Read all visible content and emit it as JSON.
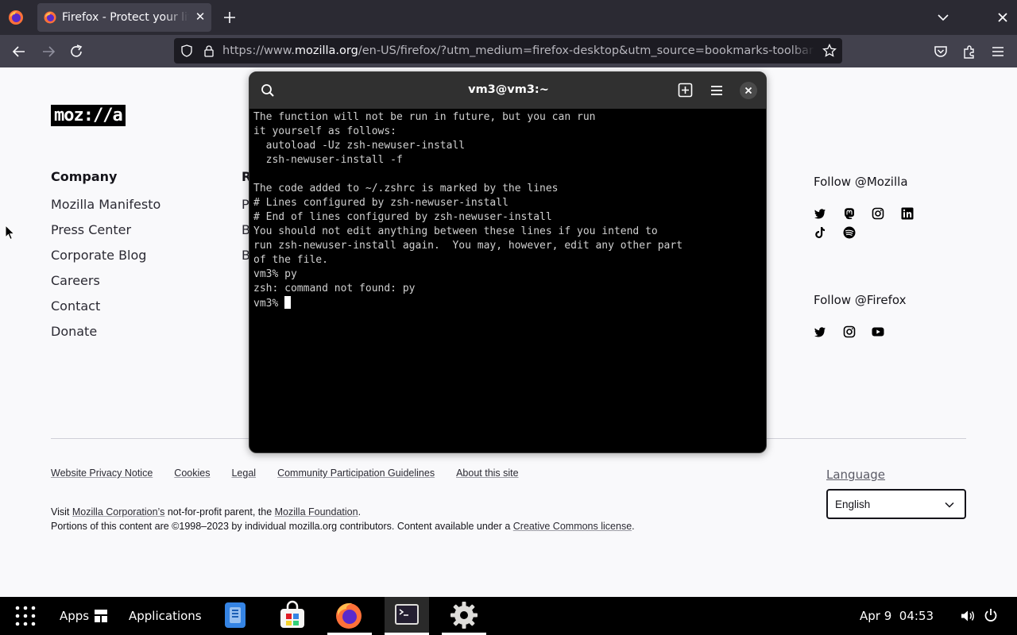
{
  "browser": {
    "tab": {
      "title": "Firefox - Protect your life online with privacy-first products"
    },
    "url": {
      "prefix": "https://www.",
      "host": "mozilla.org",
      "path": "/en-US/firefox/?utm_medium=firefox-desktop&utm_source=bookmarks-toolbar&utm_campaign=manage"
    }
  },
  "page": {
    "logo": "moz://a",
    "company": {
      "heading": "Company",
      "links": [
        "Mozilla Manifesto",
        "Press Center",
        "Corporate Blog",
        "Careers",
        "Contact",
        "Donate"
      ]
    },
    "column2": {
      "heading": "R",
      "links": [
        "P",
        "B",
        "B"
      ]
    },
    "follow_mozilla": {
      "heading": "Follow @Mozilla",
      "icons": [
        "twitter-icon",
        "mastodon-icon",
        "instagram-icon",
        "linkedin-icon",
        "tiktok-icon",
        "spotify-icon"
      ]
    },
    "follow_firefox": {
      "heading": "Follow @Firefox",
      "icons": [
        "twitter-icon",
        "instagram-icon",
        "youtube-icon"
      ]
    },
    "legal_links": [
      "Website Privacy Notice",
      "Cookies",
      "Legal",
      "Community Participation Guidelines",
      "About this site"
    ],
    "footer": {
      "line1_pre": "Visit ",
      "line1_link1": "Mozilla Corporation’s",
      "line1_mid": " not-for-profit parent, the ",
      "line1_link2": "Mozilla Foundation",
      "line1_end": ".",
      "line2_pre": "Portions of this content are ©1998–2023 by individual mozilla.org contributors. Content available under a ",
      "line2_link": "Creative Commons license",
      "line2_end": "."
    },
    "language": {
      "label": "Language",
      "selected": "English"
    }
  },
  "terminal": {
    "title": "vm3@vm3:~",
    "lines": [
      "The function will not be run in future, but you can run",
      "it yourself as follows:",
      "  autoload -Uz zsh-newuser-install",
      "  zsh-newuser-install -f",
      "",
      "The code added to ~/.zshrc is marked by the lines",
      "# Lines configured by zsh-newuser-install",
      "# End of lines configured by zsh-newuser-install",
      "You should not edit anything between these lines if you intend to",
      "run zsh-newuser-install again.  You may, however, edit any other part",
      "of the file.",
      "vm3% py",
      "zsh: command not found: py"
    ],
    "prompt": "vm3% "
  },
  "taskbar": {
    "apps_label": "Apps",
    "applications_label": "Applications",
    "dock": [
      "files-icon",
      "software-store-icon",
      "firefox-icon",
      "terminal-icon",
      "settings-icon"
    ],
    "clock": "Apr 9  04:53"
  },
  "colors": {
    "tabbar": "#2b2a33",
    "navbar": "#42414d",
    "terminal_bg": "#000000",
    "terminal_header": "#303030",
    "page_bg": "#f9f9fb"
  }
}
